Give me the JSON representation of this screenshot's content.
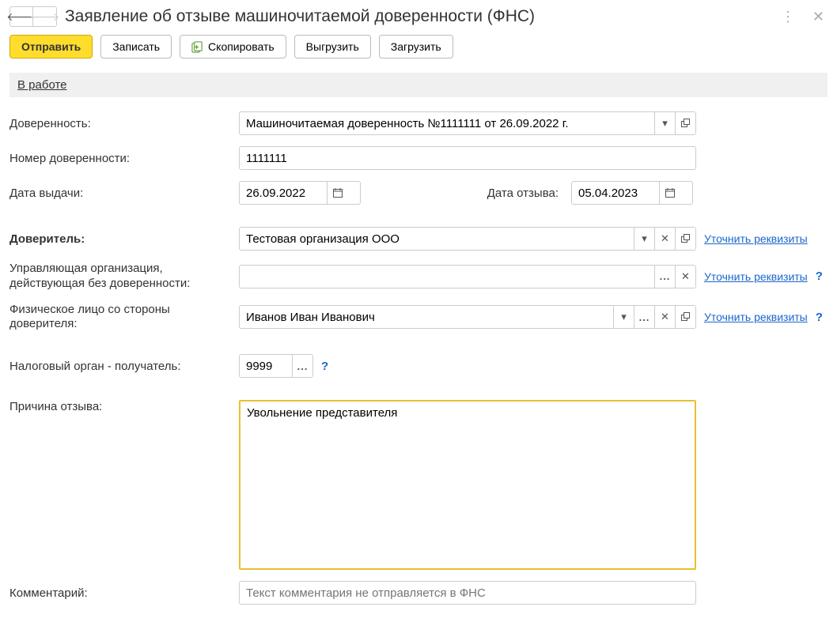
{
  "header": {
    "title": "Заявление об отзыве машиночитаемой доверенности (ФНС)"
  },
  "toolbar": {
    "send": "Отправить",
    "save": "Записать",
    "copy": "Скопировать",
    "export": "Выгрузить",
    "import": "Загрузить"
  },
  "status": {
    "label": "В работе"
  },
  "labels": {
    "poa": "Доверенность:",
    "poa_number": "Номер доверенности:",
    "issue_date": "Дата выдачи:",
    "revoke_date": "Дата отзыва:",
    "principal": "Доверитель:",
    "managing_org": "Управляющая организация, действующая без доверенности:",
    "principal_person": "Физическое лицо со стороны доверителя:",
    "tax_authority": "Налоговый орган - получатель:",
    "reason": "Причина отзыва:",
    "comment": "Комментарий:",
    "clarify": "Уточнить реквизиты"
  },
  "values": {
    "poa": "Машиночитаемая доверенность №1111111 от 26.09.2022 г.",
    "poa_number": "1111111",
    "issue_date": "26.09.2022",
    "revoke_date": "05.04.2023",
    "principal": "Тестовая организация ООО",
    "managing_org": "",
    "principal_person": "Иванов Иван Иванович",
    "tax_authority": "9999",
    "reason": "Увольнение представителя",
    "comment": "",
    "comment_placeholder": "Текст комментария не отправляется в ФНС"
  }
}
